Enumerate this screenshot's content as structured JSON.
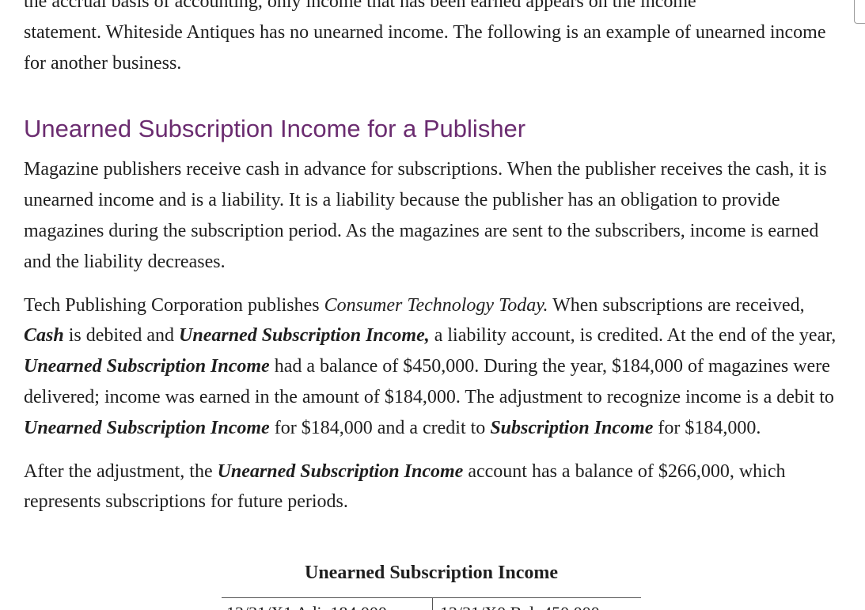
{
  "intro": {
    "cut_line": "the accrual basis of accounting, only income that has been earned appears on the income",
    "line_2": "statement. Whiteside Antiques has no unearned income. The following is an example of unearned income for another business."
  },
  "section_heading": "Unearned Subscription Income for a Publisher",
  "para1": "Magazine publishers receive cash in advance for subscriptions. When the publisher receives the cash, it is unearned income and is a liability. It is a liability because the publisher has an obligation to provide magazines during the subscription period. As the magazines are sent to the subscribers, income is earned and the liability decreases.",
  "para2": {
    "s1": "Tech Publishing Corporation publishes ",
    "magazine_title": "Consumer Technology Today.",
    "s2": " When subscriptions are received, ",
    "acct_cash": "Cash",
    "s3": " is debited and ",
    "acct_unearned_1": "Unearned Subscription Income,",
    "s4": " a liability account, is credited. At the end of the year, ",
    "acct_unearned_2": "Unearned Subscription Income",
    "s5": " had a balance of $450,000. During the year, $184,000 of magazines were delivered; income was earned in the amount of $184,000. The adjustment to recognize income is a debit to ",
    "acct_unearned_3": "Unearned Subscription Income",
    "s6": " for $184,000 and a credit to ",
    "acct_subscription": "Subscription Income",
    "s7": " for $184,000."
  },
  "para3": {
    "s1": "After the adjustment, the ",
    "acct_unearned": "Unearned Subscription Income",
    "s2": " account has a balance of $266,000, which represents subscriptions for future periods."
  },
  "t_account": {
    "title": "Unearned Subscription Income",
    "debit_entry": "12/31/X1 Adj. 184,000",
    "credit_entry": "12/31/X0 Bal. 450,000"
  }
}
